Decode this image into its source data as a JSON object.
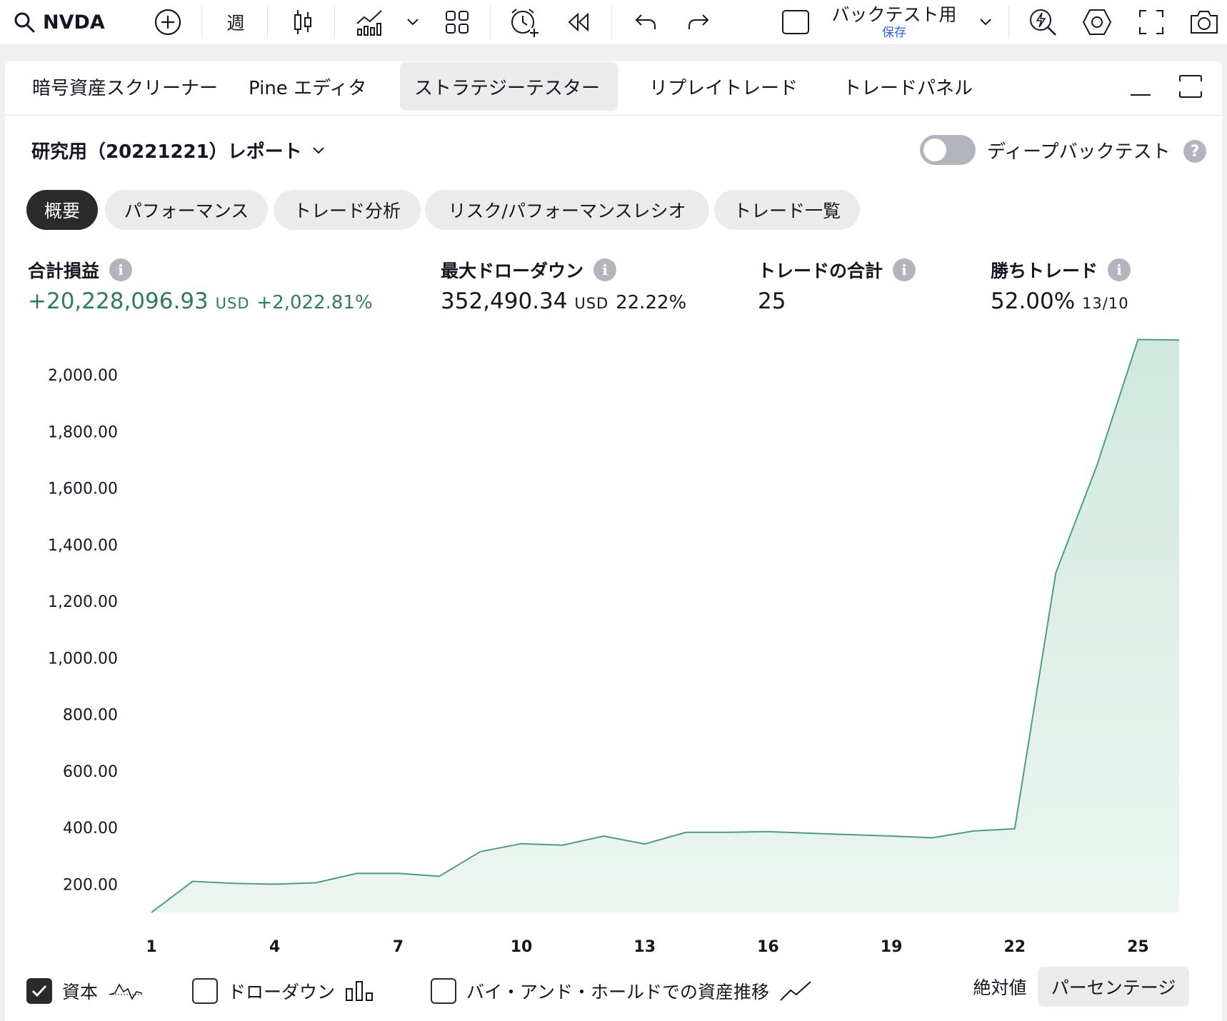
{
  "toolbar": {
    "symbol": "NVDA",
    "interval": "週",
    "layout_name": "バックテスト用",
    "layout_status": "保存"
  },
  "tabs": [
    {
      "label": "暗号資産スクリーナー",
      "active": false
    },
    {
      "label": "Pine エディタ",
      "active": false
    },
    {
      "label": "ストラテジーテスター",
      "active": true
    },
    {
      "label": "リプレイトレード",
      "active": false
    },
    {
      "label": "トレードパネル",
      "active": false
    }
  ],
  "report": {
    "title": "研究用（20221221）レポート",
    "deep_backtest_label": "ディープバックテスト",
    "deep_backtest_enabled": false,
    "help_glyph": "?"
  },
  "pills": [
    {
      "label": "概要",
      "active": true
    },
    {
      "label": "パフォーマンス",
      "active": false
    },
    {
      "label": "トレード分析",
      "active": false
    },
    {
      "label": "リスク/パフォーマンスレシオ",
      "active": false
    },
    {
      "label": "トレード一覧",
      "active": false
    }
  ],
  "stats": {
    "net_profit": {
      "label": "合計損益",
      "value": "+20,228,096.93",
      "unit": "USD",
      "pct": "+2,022.81%"
    },
    "max_drawdown": {
      "label": "最大ドローダウン",
      "value": "352,490.34",
      "unit": "USD",
      "pct": "22.22%"
    },
    "total_trades": {
      "label": "トレードの合計",
      "value": "25"
    },
    "winning_trades": {
      "label": "勝ちトレード",
      "value": "52.00%",
      "ratio": "13/10"
    }
  },
  "chart_data": {
    "type": "area",
    "x": [
      1,
      2,
      3,
      4,
      5,
      6,
      7,
      8,
      9,
      10,
      11,
      12,
      13,
      14,
      15,
      16,
      17,
      18,
      19,
      20,
      21,
      22,
      23,
      24,
      25,
      26
    ],
    "values": [
      100,
      210,
      203,
      200,
      205,
      238,
      238,
      228,
      315,
      343,
      338,
      370,
      342,
      383,
      383,
      386,
      380,
      375,
      370,
      364,
      388,
      396,
      1300,
      1680,
      2125,
      2123
    ],
    "xticks": [
      "1",
      "4",
      "7",
      "10",
      "13",
      "16",
      "19",
      "22",
      "25"
    ],
    "yticks": [
      "200.00",
      "400.00",
      "600.00",
      "800.00",
      "1,000.00",
      "1,200.00",
      "1,400.00",
      "1,600.00",
      "1,800.00",
      "2,000.00"
    ],
    "line_color": "#4a9f82",
    "fill_color": "#d3ebe3"
  },
  "legend": {
    "equity": {
      "label": "資本",
      "checked": true
    },
    "drawdown": {
      "label": "ドローダウン",
      "checked": false
    },
    "buy_hold": {
      "label": "バイ・アンド・ホールドでの資産推移",
      "checked": false
    },
    "absolute": "絶対値",
    "percentage": "パーセンテージ"
  }
}
